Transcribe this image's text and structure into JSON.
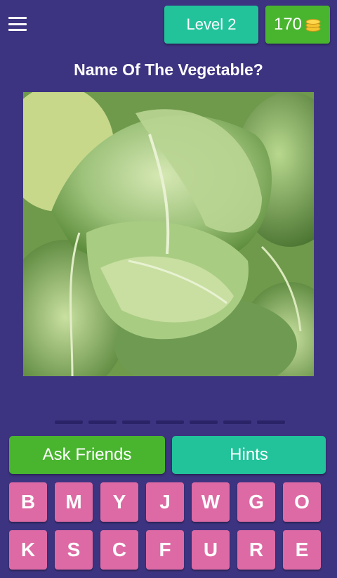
{
  "header": {
    "menu_icon": "hamburger-menu-icon",
    "level_label": "Level 2",
    "coins": "170",
    "coin_icon": "coin-stack-icon"
  },
  "question": "Name Of The Vegetable?",
  "answer_slots": 7,
  "actions": {
    "ask_label": "Ask Friends",
    "hints_label": "Hints"
  },
  "letters": [
    "B",
    "M",
    "Y",
    "J",
    "W",
    "G",
    "O",
    "K",
    "S",
    "C",
    "F",
    "U",
    "R",
    "E"
  ],
  "colors": {
    "background": "#3d3481",
    "teal": "#22c39b",
    "green": "#49b52f",
    "key_pink": "#dd6aa4"
  }
}
